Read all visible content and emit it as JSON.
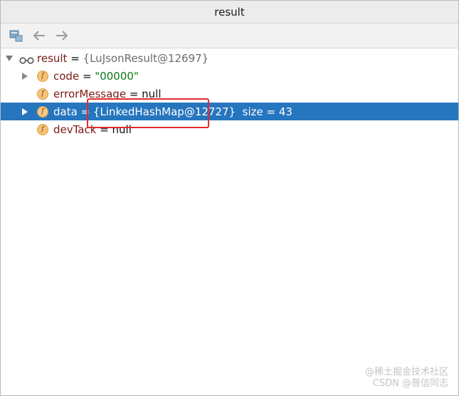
{
  "window": {
    "title": "result"
  },
  "toolbar": {
    "icons": [
      "restore-layout-icon",
      "back-arrow-icon",
      "forward-arrow-icon"
    ]
  },
  "tree": {
    "root": {
      "name": "result",
      "eq": " = ",
      "value": "{LuJsonResult@12697}"
    },
    "children": [
      {
        "name": "code",
        "eq": " = ",
        "value": "\"00000\"",
        "kind": "string",
        "expandable": true
      },
      {
        "name": "errorMessage",
        "eq": " = ",
        "value": "null",
        "kind": "plain",
        "expandable": false
      },
      {
        "name": "data",
        "eq": " = ",
        "value": "{LinkedHashMap@12727}",
        "extra": "size = 43",
        "kind": "object",
        "expandable": true,
        "selected": true
      },
      {
        "name": "devTack",
        "eq": " = ",
        "value": "null",
        "kind": "plain",
        "expandable": false
      }
    ],
    "field_badge": "f"
  },
  "watermark": {
    "line1": "@稀土掘金技术社区",
    "line2": "CSDN @普信同志"
  },
  "colors": {
    "selection": "#2675bf",
    "field_name": "#7a1b14",
    "string_value": "#0b7a1b",
    "object_value": "#6b6b6b",
    "annotation_box": "#e52a2a"
  }
}
